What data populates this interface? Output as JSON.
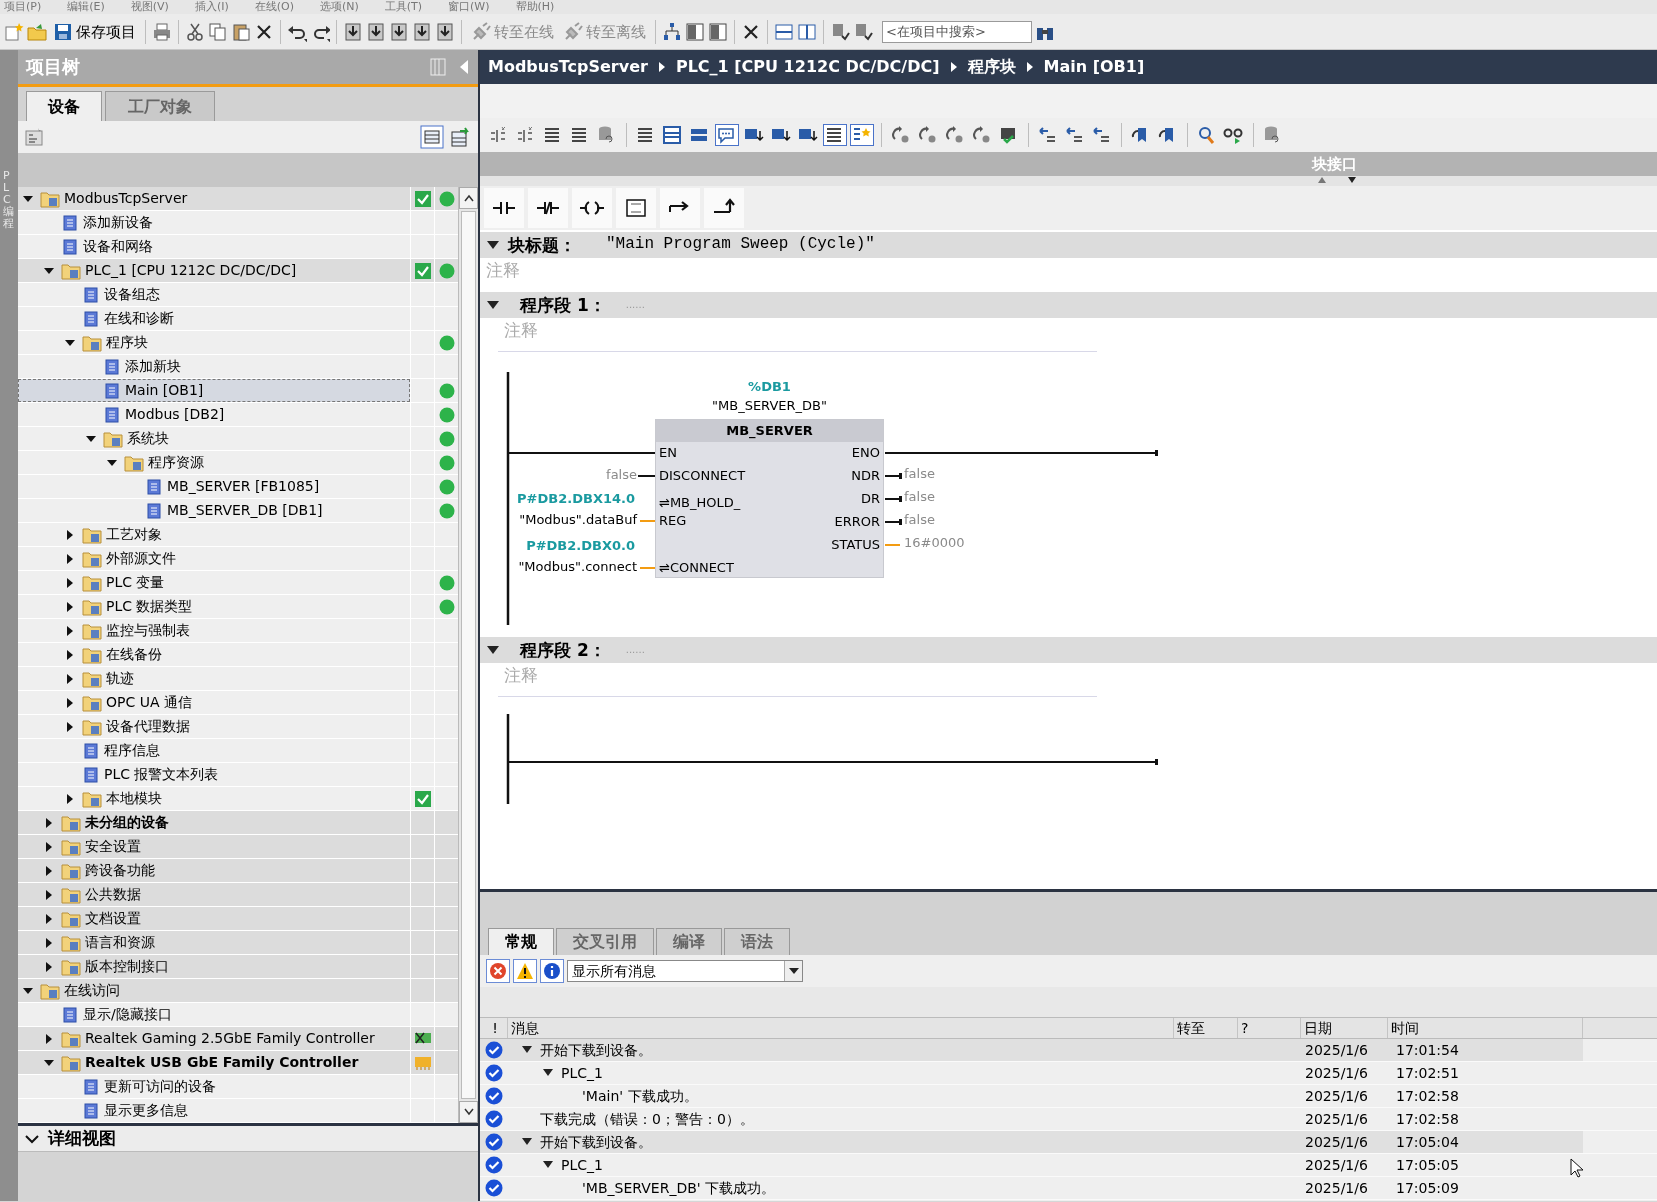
{
  "menu": [
    "项目(P)",
    "编辑(E)",
    "视图(V)",
    "插入(I)",
    "在线(O)",
    "选项(N)",
    "工具(T)",
    "窗口(W)",
    "帮助(H)"
  ],
  "toolbar": {
    "buttons": [
      {
        "label": "保存项目",
        "disabled": false
      },
      {
        "label": "转至在线",
        "disabled": true
      },
      {
        "label": "转至离线",
        "disabled": true
      }
    ],
    "search": {
      "placeholder": "<在项目中搜索>"
    }
  },
  "side_strip": {
    "label": "PLC 编程"
  },
  "project_tree": {
    "title": "项目树",
    "tabs": [
      {
        "label": "设备",
        "selected": true
      },
      {
        "label": "工厂对象",
        "selected": false
      }
    ],
    "items": [
      {
        "label": "ModbusTcpServer",
        "selected": false,
        "expanded": true,
        "consistent": true,
        "online": true,
        "children": [
          {
            "label": "添加新设备",
            "selected": false
          },
          {
            "label": "设备和网络",
            "selected": false
          },
          {
            "label": "PLC_1 [CPU 1212C DC/DC/DC]",
            "selected": false,
            "expanded": true,
            "consistent": true,
            "online": true,
            "children": [
              {
                "label": "设备组态",
                "selected": false
              },
              {
                "label": "在线和诊断",
                "selected": false
              },
              {
                "label": "程序块",
                "selected": false,
                "expanded": true,
                "online": true,
                "children": [
                  {
                    "label": "添加新块",
                    "selected": false
                  },
                  {
                    "label": "Main [OB1]",
                    "selected": true,
                    "online": true
                  },
                  {
                    "label": "Modbus [DB2]",
                    "selected": false,
                    "online": true
                  },
                  {
                    "label": "系统块",
                    "selected": false,
                    "expanded": true,
                    "online": true,
                    "children": [
                      {
                        "label": "程序资源",
                        "selected": false,
                        "expanded": true,
                        "online": true,
                        "children": [
                          {
                            "label": "MB_SERVER [FB1085]",
                            "selected": false,
                            "online": true
                          },
                          {
                            "label": "MB_SERVER_DB [DB1]",
                            "selected": false,
                            "online": true
                          }
                        ]
                      }
                    ]
                  }
                ]
              },
              {
                "label": "工艺对象",
                "selected": false,
                "expanded": false
              },
              {
                "label": "外部源文件",
                "selected": false,
                "expanded": false
              },
              {
                "label": "PLC 变量",
                "selected": false,
                "expanded": false,
                "online": true
              },
              {
                "label": "PLC 数据类型",
                "selected": false,
                "expanded": false,
                "online": true
              },
              {
                "label": "监控与强制表",
                "selected": false,
                "expanded": false
              },
              {
                "label": "在线备份",
                "selected": false,
                "expanded": false
              },
              {
                "label": "轨迹",
                "selected": false,
                "expanded": false
              },
              {
                "label": "OPC UA 通信",
                "selected": false,
                "expanded": false
              },
              {
                "label": "设备代理数据",
                "selected": false,
                "expanded": false
              },
              {
                "label": "程序信息",
                "selected": false
              },
              {
                "label": "PLC 报警文本列表",
                "selected": false
              },
              {
                "label": "本地模块",
                "selected": false,
                "expanded": false,
                "consistent": true
              }
            ]
          },
          {
            "label": "未分组的设备",
            "selected": false,
            "expanded": false,
            "bold": true
          },
          {
            "label": "安全设置",
            "selected": false,
            "expanded": false
          },
          {
            "label": "跨设备功能",
            "selected": false,
            "expanded": false
          },
          {
            "label": "公共数据",
            "selected": false,
            "expanded": false
          },
          {
            "label": "文档设置",
            "selected": false,
            "expanded": false
          },
          {
            "label": "语言和资源",
            "selected": false,
            "expanded": false
          },
          {
            "label": "版本控制接口",
            "selected": false,
            "expanded": false
          }
        ]
      },
      {
        "label": "在线访问",
        "selected": false,
        "expanded": true,
        "children": [
          {
            "label": "显示/隐藏接口",
            "selected": false
          },
          {
            "label": "Realtek Gaming 2.5GbE Family Controller",
            "selected": false,
            "expanded": false,
            "adapter_connected": false
          },
          {
            "label": "Realtek USB GbE Family Controller",
            "selected": false,
            "expanded": true,
            "bold": true,
            "adapter_connected": true,
            "children": [
              {
                "label": "更新可访问的设备",
                "selected": false
              },
              {
                "label": "显示更多信息",
                "selected": false
              }
            ]
          }
        ]
      }
    ]
  },
  "detail_view": {
    "title": "详细视图",
    "expanded": true
  },
  "editor": {
    "breadcrumb": [
      "ModbusTcpServer",
      "PLC_1 [CPU 1212C DC/DC/DC]",
      "程序块",
      "Main [OB1]"
    ],
    "interface_label": "块接口",
    "block_title": {
      "label": "块标题：",
      "value": "\"Main Program Sweep (Cycle)\"",
      "comment": "注释",
      "expanded": true
    },
    "networks": [
      {
        "title": "程序段 1：",
        "dots": "......",
        "comment": "注释",
        "expanded": true,
        "block": {
          "instance": "%DB1",
          "instance_name": "\"MB_SERVER_DB\"",
          "name": "MB_SERVER",
          "inputs": [
            {
              "pin": [
                "EN"
              ],
              "kind": "flow"
            },
            {
              "pin": [
                "DISCONNECT"
              ],
              "kind": "const",
              "value": "false"
            },
            {
              "pin": [
                "⇌MB_HOLD_",
                "REG"
              ],
              "kind": "var",
              "address": "P#DB2.DBX14.0",
              "value": "\"Modbus\".dataBuf"
            },
            {
              "pin": [
                "⇌CONNECT"
              ],
              "kind": "var",
              "address": "P#DB2.DBX0.0",
              "value": "\"Modbus\".connect"
            }
          ],
          "outputs": [
            {
              "pin": "ENO",
              "kind": "flow"
            },
            {
              "pin": "NDR",
              "kind": "bool",
              "value": "false"
            },
            {
              "pin": "DR",
              "kind": "bool",
              "value": "false"
            },
            {
              "pin": "ERROR",
              "kind": "bool",
              "value": "false"
            },
            {
              "pin": "STATUS",
              "kind": "word",
              "value": "16#0000"
            }
          ]
        }
      },
      {
        "title": "程序段 2：",
        "dots": "......",
        "comment": "注释",
        "expanded": true
      }
    ]
  },
  "inspector": {
    "tabs": [
      {
        "label": "常规",
        "selected": true
      },
      {
        "label": "交叉引用",
        "selected": false
      },
      {
        "label": "编译",
        "selected": false
      },
      {
        "label": "语法",
        "selected": false
      }
    ],
    "filters": [
      {
        "kind": "error",
        "on": true
      },
      {
        "kind": "warning",
        "on": true
      },
      {
        "kind": "info",
        "on": true
      }
    ],
    "filter_select": "显示所有消息",
    "columns": [
      "!",
      "消息",
      "转至",
      "?",
      "日期",
      "时间"
    ],
    "messages": [
      {
        "success": true,
        "text": "开始下载到设备。",
        "date": "2025/1/6",
        "time": "17:01:54",
        "expanded": true,
        "children": [
          {
            "success": true,
            "text": "PLC_1",
            "date": "2025/1/6",
            "time": "17:02:51",
            "expanded": true,
            "children": [
              {
                "success": true,
                "text": "'Main' 下载成功。",
                "date": "2025/1/6",
                "time": "17:02:58"
              }
            ]
          }
        ]
      },
      {
        "success": true,
        "text": "下载完成（错误：0；警告：0）。",
        "date": "2025/1/6",
        "time": "17:02:58"
      },
      {
        "success": true,
        "text": "开始下载到设备。",
        "date": "2025/1/6",
        "time": "17:05:04",
        "expanded": true,
        "children": [
          {
            "success": true,
            "text": "PLC_1",
            "date": "2025/1/6",
            "time": "17:05:05",
            "expanded": true,
            "children": [
              {
                "success": true,
                "text": "'MB_SERVER_DB' 下载成功。",
                "date": "2025/1/6",
                "time": "17:05:09"
              }
            ]
          }
        ]
      }
    ]
  }
}
